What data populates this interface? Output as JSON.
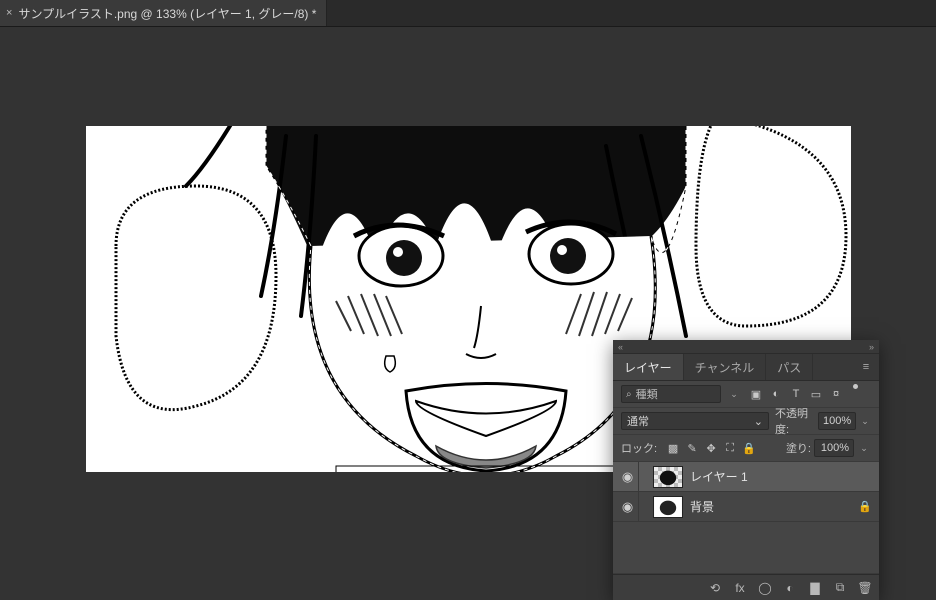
{
  "tab": {
    "close_glyph": "×",
    "title": "サンプルイラスト.png @ 133% (レイヤー 1, グレー/8) *"
  },
  "panel": {
    "collapse_glyph": "«",
    "expand_glyph": "»",
    "tabs": {
      "layers": "レイヤー",
      "channels": "チャンネル",
      "paths": "パス"
    },
    "menu_glyph": "≡",
    "search": {
      "icon": "⌕",
      "label": "種類",
      "chev": "⌄"
    },
    "filter_icons": {
      "image": "▣",
      "adjust": "◐",
      "text": "T",
      "shape": "▭",
      "smart": "¤"
    },
    "blend": {
      "mode": "通常",
      "chev": "⌄",
      "opacity_label": "不透明度:",
      "opacity_value": "100%",
      "opacity_chev": "⌄"
    },
    "lock": {
      "label": "ロック:",
      "icons": {
        "pixel": "▩",
        "brush": "✎",
        "move": "✥",
        "artboard": "⛶",
        "all": "🔒"
      },
      "fill_label": "塗り:",
      "fill_value": "100%",
      "fill_chev": "⌄"
    },
    "layers": [
      {
        "eye": "◉",
        "name": "レイヤー 1",
        "locked": false,
        "selected": true
      },
      {
        "eye": "◉",
        "name": "背景",
        "locked": true,
        "selected": false
      }
    ],
    "footer": {
      "link": "⟲",
      "fx": "fx",
      "mask": "◯",
      "adjust": "◐",
      "group": "▇",
      "new": "⧉",
      "trash": "🗑"
    }
  }
}
